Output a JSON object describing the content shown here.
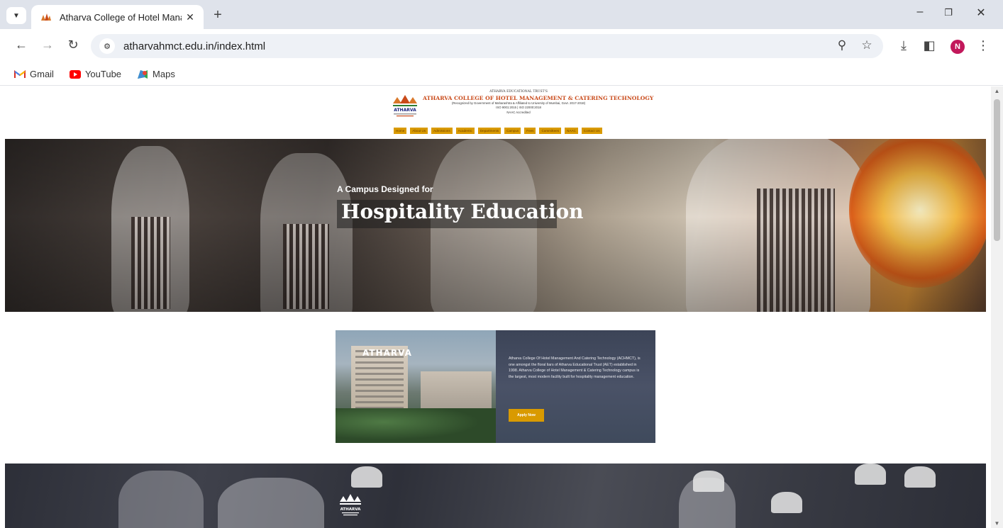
{
  "browser": {
    "tab_title": "Atharva College of Hotel Manag",
    "url": "atharvahmct.edu.in/index.html",
    "profile_initial": "N",
    "bookmarks": [
      {
        "label": "Gmail",
        "icon": "gmail-icon"
      },
      {
        "label": "YouTube",
        "icon": "youtube-icon"
      },
      {
        "label": "Maps",
        "icon": "maps-icon"
      }
    ]
  },
  "header": {
    "trust": "ATHARVA EDUCATIONAL TRUST'S",
    "college_name": "ATHARVA COLLEGE OF HOTEL MANAGEMENT & CATERING TECHNOLOGY",
    "subtitle": "(Recognized by Government of Maharashtra & Affiliated to University of Mumbai, Govt. 2017-2018)",
    "iso": "ISO 9001:2015 | ISO 22000:2018",
    "naac": "NAAC Accredited",
    "logo_text": "ATHARVA",
    "nav": [
      "Home",
      "About Us",
      "Admissions",
      "Academic",
      "Departments",
      "Campus",
      "Fees",
      "Committees",
      "NAAC",
      "Contact Us"
    ]
  },
  "hero": {
    "kicker": "A Campus Designed for",
    "title": "Hospitality Education"
  },
  "about": {
    "sign": "ATHARVA",
    "paragraph": "Atharva College Of Hotel Management And Catering Technology (ACHMCT), is one amongst the floral liars of Atharva Educational Trust (AET) established in 1998. Atharva College of Hotel Management & Catering Technology campus is the largest, most modern facility built for hospitality management education.",
    "apply_label": "Apply Now"
  },
  "band": {
    "logo_text": "ATHARVA"
  },
  "colors": {
    "accent": "#d99a00",
    "brand_red": "#c94a1a",
    "panel": "#434b5e"
  }
}
